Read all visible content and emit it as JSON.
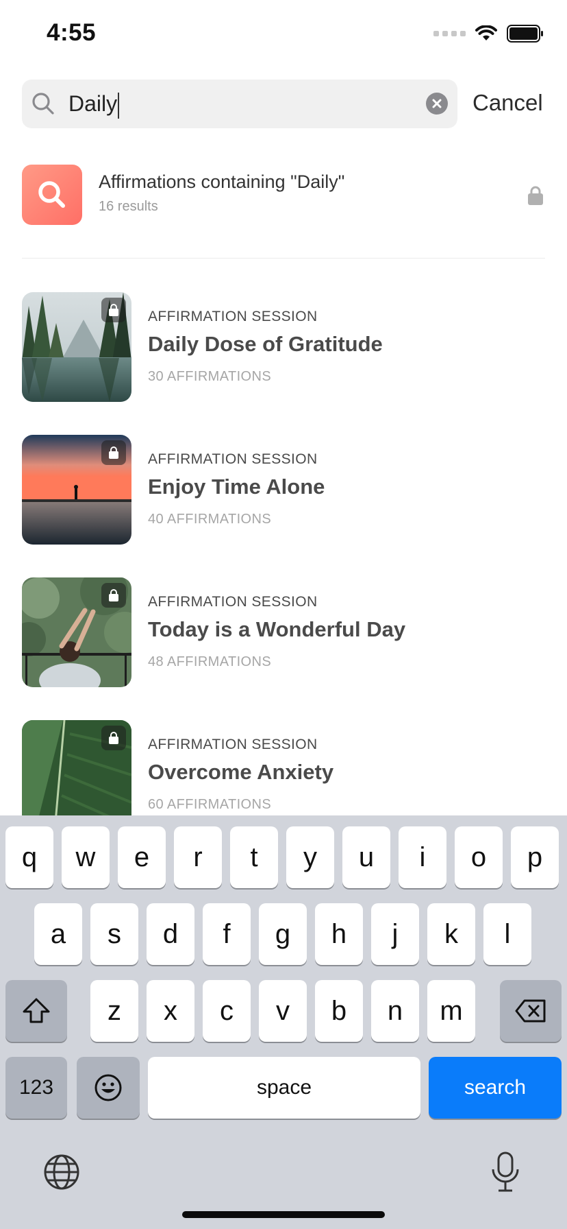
{
  "status_bar": {
    "time": "4:55"
  },
  "search": {
    "query": "Daily",
    "cancel_label": "Cancel"
  },
  "suggestion": {
    "title": "Affirmations containing \"Daily\"",
    "subtitle": "16 results"
  },
  "results": [
    {
      "category": "AFFIRMATION SESSION",
      "title": "Daily Dose of Gratitude",
      "count": "30 AFFIRMATIONS",
      "locked": true
    },
    {
      "category": "AFFIRMATION SESSION",
      "title": "Enjoy Time Alone",
      "count": "40 AFFIRMATIONS",
      "locked": true
    },
    {
      "category": "AFFIRMATION SESSION",
      "title": "Today is a Wonderful Day",
      "count": "48 AFFIRMATIONS",
      "locked": true
    },
    {
      "category": "AFFIRMATION SESSION",
      "title": "Overcome Anxiety",
      "count": "60 AFFIRMATIONS",
      "locked": true
    }
  ],
  "keyboard": {
    "row1": [
      "q",
      "w",
      "e",
      "r",
      "t",
      "y",
      "u",
      "i",
      "o",
      "p"
    ],
    "row2": [
      "a",
      "s",
      "d",
      "f",
      "g",
      "h",
      "j",
      "k",
      "l"
    ],
    "row3": [
      "z",
      "x",
      "c",
      "v",
      "b",
      "n",
      "m"
    ],
    "numbers_label": "123",
    "space_label": "space",
    "search_label": "search"
  },
  "colors": {
    "accent": "#0a7cfa",
    "suggestion_tile": "#ff7f72"
  }
}
